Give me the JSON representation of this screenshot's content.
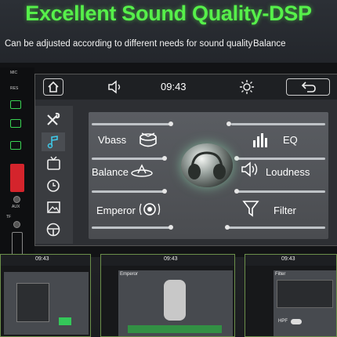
{
  "banner": {
    "headline": "Excellent Sound Quality-DSP",
    "subline": "Can be adjusted according to different needs for sound quality",
    "tag": "Balance"
  },
  "panel": {
    "mic": "MIC",
    "res": "RES",
    "aux": "AUX",
    "tf": "TF",
    "usb": "USB"
  },
  "topbar": {
    "time": "09:43"
  },
  "sidebar": {
    "items": [
      "tools",
      "music",
      "tv",
      "clock",
      "image",
      "steering-wheel"
    ]
  },
  "dsp": {
    "vbass": "Vbass",
    "eq": "EQ",
    "balance": "Balance",
    "loudness": "Loudness",
    "emperor": "Emperor",
    "filter": "Filter"
  },
  "thumbs": [
    {
      "time": "09:43"
    },
    {
      "time": "09:43",
      "title": "Emperor"
    },
    {
      "time": "09:43",
      "title": "Filter",
      "hpf": "HPF"
    }
  ],
  "colors": {
    "headline": "#56f04a",
    "accent": "#39d353"
  }
}
